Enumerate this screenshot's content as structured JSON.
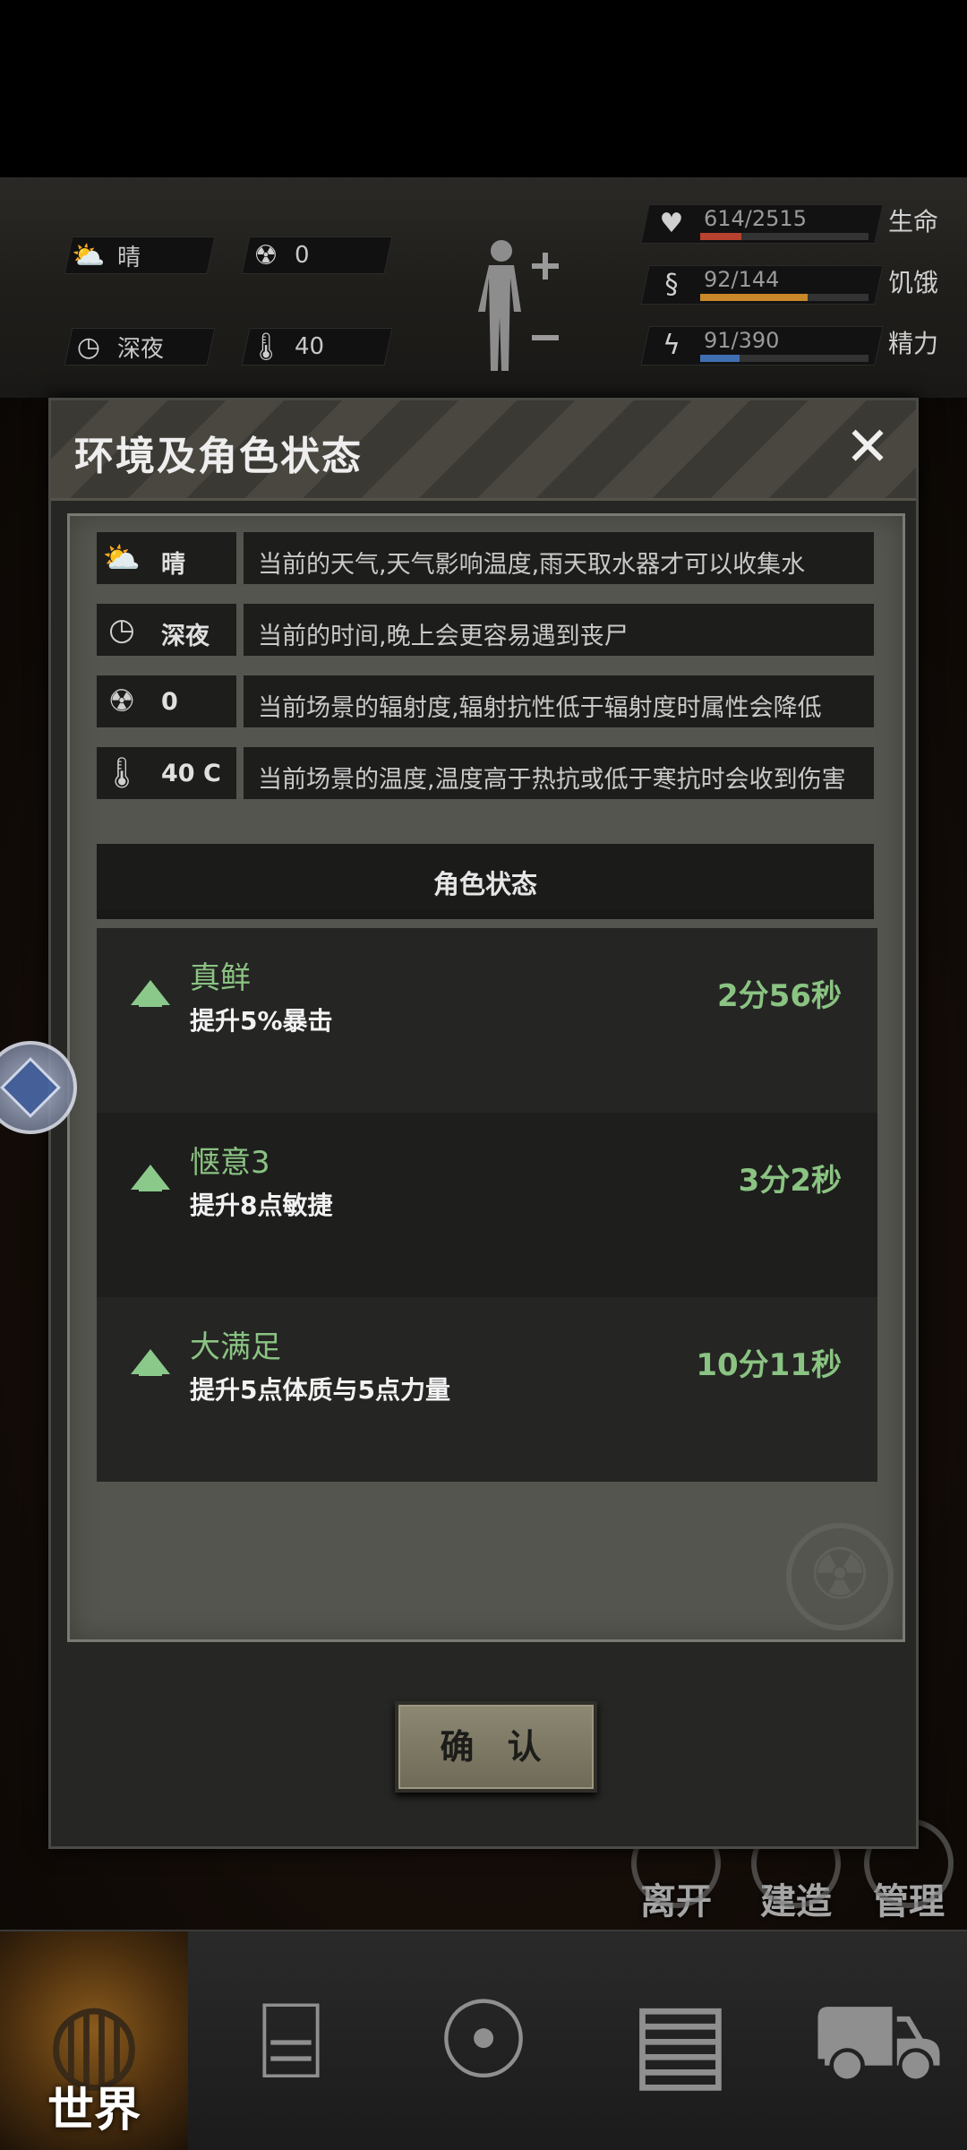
{
  "hud": {
    "weather": {
      "icon": "cloud-sun-icon",
      "value": "晴"
    },
    "radiation": {
      "icon": "radiation-icon",
      "value": "0"
    },
    "time": {
      "icon": "clock-icon",
      "value": "深夜"
    },
    "temperature": {
      "icon": "thermometer-icon",
      "value": "40"
    },
    "stats": [
      {
        "icon": "heart-pulse-icon",
        "value": "614/2515",
        "label": "生命",
        "fraction": 0.244,
        "color": "#b8412f"
      },
      {
        "icon": "stomach-icon",
        "value": "92/144",
        "label": "饥饿",
        "fraction": 0.639,
        "color": "#c9892a"
      },
      {
        "icon": "brain-energy-icon",
        "value": "91/390",
        "label": "精力",
        "fraction": 0.233,
        "color": "#3f6fb0"
      }
    ]
  },
  "modal": {
    "title": "环境及角色状态",
    "environment": [
      {
        "icon": "cloud-sun-icon",
        "value": "晴",
        "description": "当前的天气,天气影响温度,雨天取水器才可以收集水"
      },
      {
        "icon": "clock-icon",
        "value": "深夜",
        "description": "当前的时间,晚上会更容易遇到丧尸"
      },
      {
        "icon": "radiation-icon",
        "value": "0",
        "description": "当前场景的辐射度,辐射抗性低于辐射度时属性会降低"
      },
      {
        "icon": "thermometer-icon",
        "value": "40 C",
        "description": "当前场景的温度,温度高于热抗或低于寒抗时会收到伤害"
      }
    ],
    "status_title": "角色状态",
    "effects": [
      {
        "name": "真鲜",
        "description": "提升5%暴击",
        "time": "2分56秒"
      },
      {
        "name": "惬意3",
        "description": "提升8点敏捷",
        "time": "3分2秒"
      },
      {
        "name": "大满足",
        "description": "提升5点体质与5点力量",
        "time": "10分11秒"
      }
    ],
    "confirm_label": "确 认"
  },
  "scene_buttons": [
    {
      "label": "离开",
      "icon": "exit-icon"
    },
    {
      "label": "建造",
      "icon": "build-icon"
    },
    {
      "label": "管理",
      "icon": "gear-icon"
    }
  ],
  "bottom_nav": [
    {
      "label": "世界",
      "icon": "globe-icon",
      "active": true
    },
    {
      "label": "",
      "icon": "backpack-icon"
    },
    {
      "label": "",
      "icon": "head-gears-icon"
    },
    {
      "label": "",
      "icon": "radio-icon"
    },
    {
      "label": "",
      "icon": "cart-icon"
    }
  ]
}
